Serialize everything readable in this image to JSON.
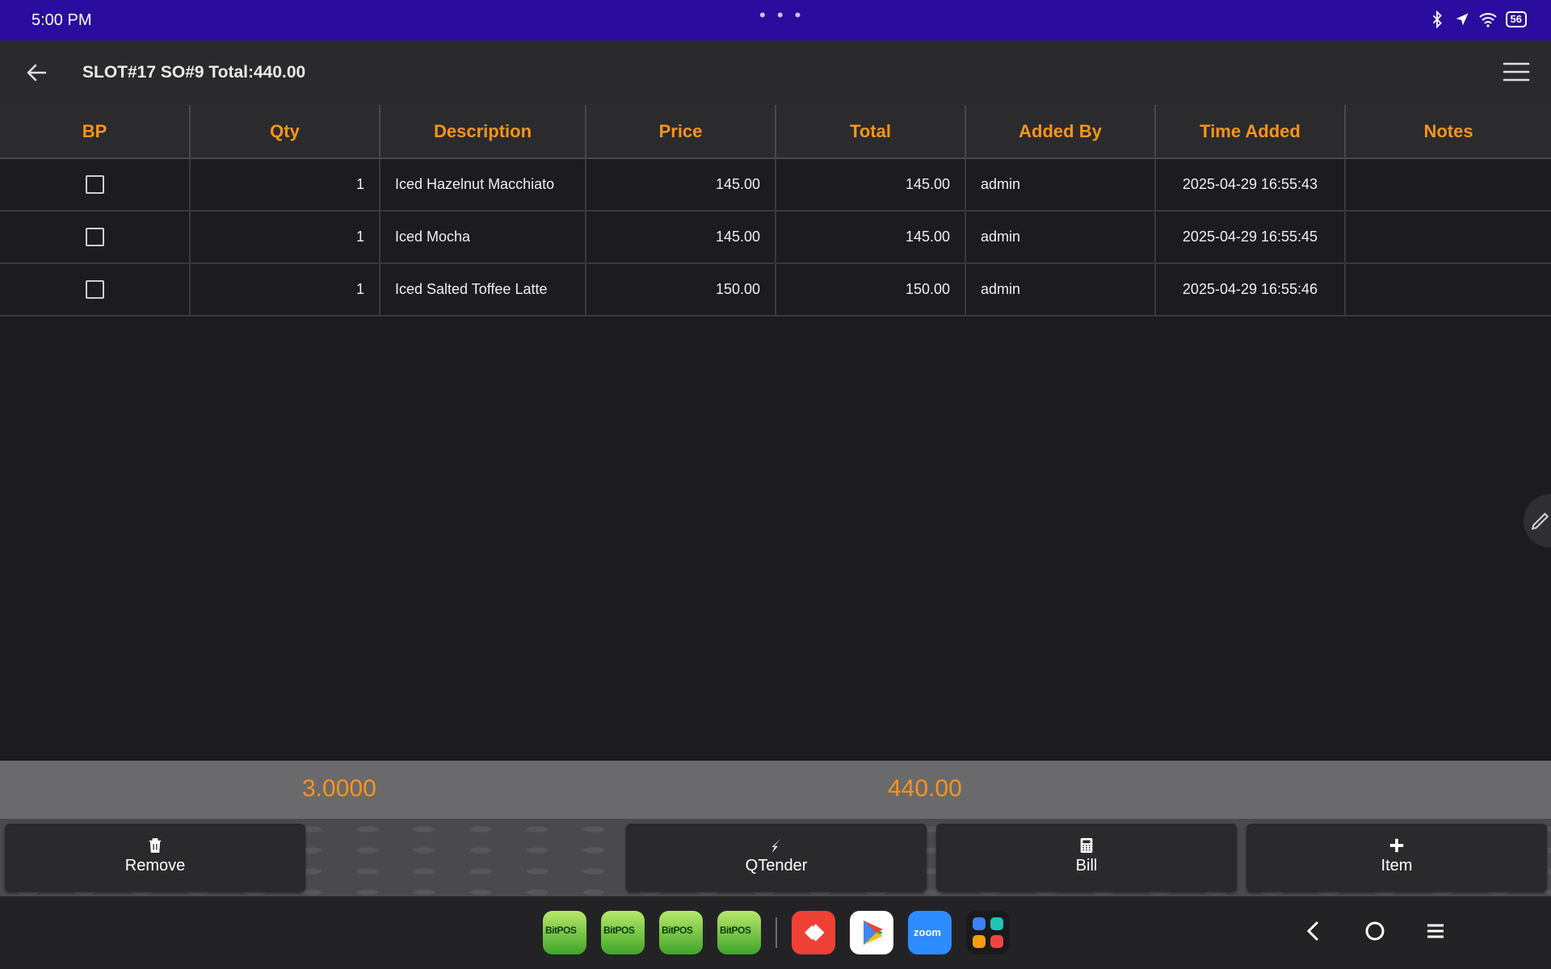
{
  "status_bar": {
    "time": "5:00 PM",
    "battery": "56"
  },
  "app_bar": {
    "title": "SLOT#17 SO#9 Total:440.00"
  },
  "table": {
    "columns": [
      "BP",
      "Qty",
      "Description",
      "Price",
      "Total",
      "Added By",
      "Time Added",
      "Notes"
    ],
    "rows": [
      {
        "bp": false,
        "qty": "1",
        "description": "Iced Hazelnut Macchiato",
        "price": "145.00",
        "total": "145.00",
        "added_by": "admin",
        "time_added": "2025-04-29 16:55:43",
        "notes": ""
      },
      {
        "bp": false,
        "qty": "1",
        "description": "Iced Mocha",
        "price": "145.00",
        "total": "145.00",
        "added_by": "admin",
        "time_added": "2025-04-29 16:55:45",
        "notes": ""
      },
      {
        "bp": false,
        "qty": "1",
        "description": "Iced Salted Toffee Latte",
        "price": "150.00",
        "total": "150.00",
        "added_by": "admin",
        "time_added": "2025-04-29 16:55:46",
        "notes": ""
      }
    ]
  },
  "summary": {
    "total_qty": "3.0000",
    "total_amount": "440.00"
  },
  "actions": {
    "remove": "Remove",
    "qtender": "QTender",
    "bill": "Bill",
    "item": "Item"
  },
  "dock": {
    "bitpos_label": "BitPOS",
    "zoom_label": "zoom"
  },
  "colors": {
    "accent": "#f7941d",
    "status_bar": "#2a0c9e"
  }
}
